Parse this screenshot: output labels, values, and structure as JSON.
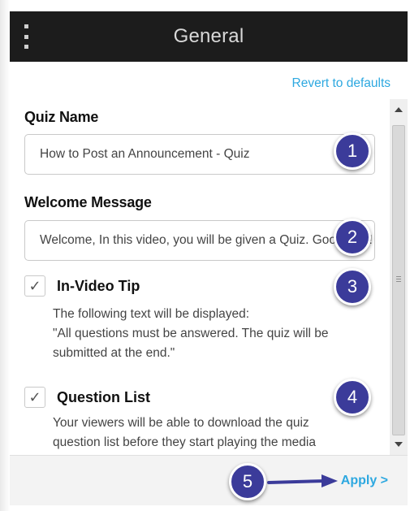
{
  "header": {
    "title": "General"
  },
  "revert_label": "Revert to defaults",
  "quiz_name": {
    "label": "Quiz Name",
    "value": "How to Post an Announcement - Quiz"
  },
  "welcome": {
    "label": "Welcome Message",
    "value": "Welcome, In this video, you will be given a Quiz. Good luck!"
  },
  "in_video_tip": {
    "label": "In-Video Tip",
    "checked": true,
    "check_glyph": "✓",
    "desc_line1": "The following text will be displayed:",
    "desc_line2": "\"All questions must be answered. The quiz will be",
    "desc_line3": "submitted at the end.\""
  },
  "question_list": {
    "label": "Question List",
    "checked": true,
    "check_glyph": "✓",
    "desc_line1": "Your viewers will be able to download the quiz",
    "desc_line2": "question list before they start playing the media"
  },
  "footer": {
    "apply_label": "Apply >"
  },
  "callouts": [
    "1",
    "2",
    "3",
    "4",
    "5"
  ],
  "colors": {
    "header_bg": "#1c1c1c",
    "link": "#2da8e0",
    "callout": "#3b3b9a",
    "arrow": "#3b3b9a"
  },
  "icons": {
    "menu": "kebab-menu-icon",
    "scroll_up": "arrow-up-icon",
    "scroll_down": "arrow-down-icon",
    "arrow": "arrow-right-icon"
  }
}
